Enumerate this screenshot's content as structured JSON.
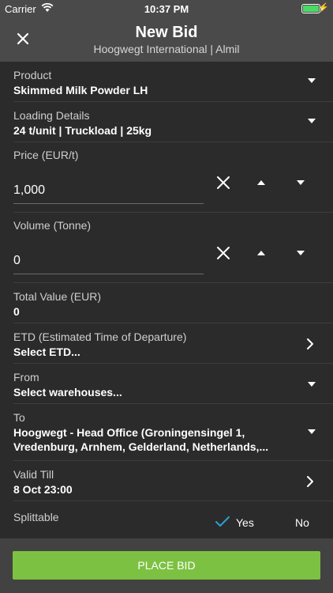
{
  "status": {
    "carrier": "Carrier",
    "time": "10:37 PM",
    "battery_level": 1.0
  },
  "nav": {
    "title": "New Bid",
    "subtitle": "Hoogwegt International | Almil"
  },
  "form": {
    "product": {
      "label": "Product",
      "value": "Skimmed Milk Powder LH"
    },
    "loading": {
      "label": "Loading Details",
      "value": "24 t/unit | Truckload | 25kg"
    },
    "price": {
      "label": "Price (EUR/t)",
      "value": "1,000"
    },
    "volume": {
      "label": "Volume (Tonne)",
      "value": "0"
    },
    "total": {
      "label": "Total Value (EUR)",
      "value": "0"
    },
    "etd": {
      "label": "ETD (Estimated Time of Departure)",
      "value": "Select ETD..."
    },
    "from": {
      "label": "From",
      "value": "Select warehouses..."
    },
    "to": {
      "label": "To",
      "value": "Hoogwegt - Head Office (Groningensingel 1, Vredenburg, Arnhem, Gelderland, Netherlands,..."
    },
    "valid_till": {
      "label": "Valid Till",
      "value": "8 Oct  23:00"
    },
    "splittable": {
      "label": "Splittable",
      "yes": "Yes",
      "no": "No",
      "selected": "Yes"
    }
  },
  "actions": {
    "place_bid": "PLACE BID"
  },
  "colors": {
    "accent": "#7dc142",
    "check": "#2a9fd6",
    "background": "#2b2b2b",
    "header": "#4a4a4a"
  },
  "icons": [
    "wifi-icon",
    "battery-icon",
    "charging-icon",
    "close-icon",
    "chevron-down-icon",
    "chevron-right-icon",
    "clear-icon",
    "arrow-up-icon",
    "arrow-down-icon",
    "checkmark-icon"
  ]
}
